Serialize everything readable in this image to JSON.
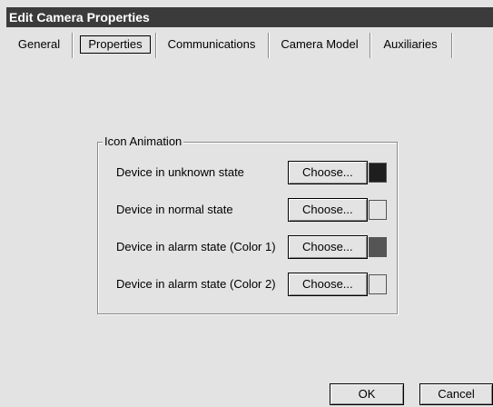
{
  "window": {
    "title": "Edit Camera Properties"
  },
  "tabs": [
    {
      "label": "General",
      "active": false
    },
    {
      "label": "Properties",
      "active": true
    },
    {
      "label": "Communications",
      "active": false
    },
    {
      "label": "Camera Model",
      "active": false
    },
    {
      "label": "Auxiliaries",
      "active": false
    }
  ],
  "icon_animation": {
    "title": "Icon Animation",
    "rows": [
      {
        "label": "Device in unknown state",
        "button": "Choose...",
        "color": "#1e1e1e"
      },
      {
        "label": "Device in normal state",
        "button": "Choose...",
        "color": "#e3e3e3"
      },
      {
        "label": "Device in alarm state (Color 1)",
        "button": "Choose...",
        "color": "#555555"
      },
      {
        "label": "Device in alarm state (Color 2)",
        "button": "Choose...",
        "color": "#e3e3e3"
      }
    ]
  },
  "footer": {
    "ok_label": "OK",
    "cancel_label": "Cancel"
  }
}
